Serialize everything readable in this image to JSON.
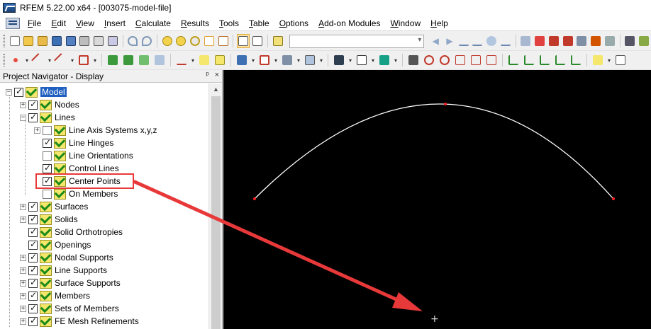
{
  "window": {
    "title": "RFEM 5.22.00 x64 - [003075-model-file]"
  },
  "menu": [
    {
      "label": "File",
      "key": "F",
      "rest": "ile"
    },
    {
      "label": "Edit",
      "key": "E",
      "rest": "dit"
    },
    {
      "label": "View",
      "key": "V",
      "rest": "iew"
    },
    {
      "label": "Insert",
      "key": "I",
      "rest": "nsert"
    },
    {
      "label": "Calculate",
      "key": "C",
      "rest": "alculate"
    },
    {
      "label": "Results",
      "key": "R",
      "rest": "esults"
    },
    {
      "label": "Tools",
      "key": "T",
      "rest": "ools"
    },
    {
      "label": "Table",
      "key": "T",
      "rest": "able"
    },
    {
      "label": "Options",
      "key": "O",
      "rest": "ptions"
    },
    {
      "label": "Add-on Modules",
      "key": "A",
      "rest": "dd-on Modules"
    },
    {
      "label": "Window",
      "key": "W",
      "rest": "indow"
    },
    {
      "label": "Help",
      "key": "H",
      "rest": "elp"
    }
  ],
  "navigator": {
    "title": "Project Navigator - Display",
    "pin_glyph": "ᵖ",
    "close_glyph": "×",
    "items": [
      {
        "label": "Model",
        "checked": true,
        "selected": true
      },
      {
        "label": "Nodes",
        "checked": true
      },
      {
        "label": "Lines",
        "checked": true
      },
      {
        "label": "Line Axis Systems x,y,z",
        "checked": false
      },
      {
        "label": "Line Hinges",
        "checked": true
      },
      {
        "label": "Line Orientations",
        "checked": false
      },
      {
        "label": "Control Lines",
        "checked": true
      },
      {
        "label": "Center Points",
        "checked": true
      },
      {
        "label": "On Members",
        "checked": false
      },
      {
        "label": "Surfaces",
        "checked": true
      },
      {
        "label": "Solids",
        "checked": true
      },
      {
        "label": "Solid Orthotropies",
        "checked": true
      },
      {
        "label": "Openings",
        "checked": true
      },
      {
        "label": "Nodal Supports",
        "checked": true
      },
      {
        "label": "Line Supports",
        "checked": true
      },
      {
        "label": "Surface Supports",
        "checked": true
      },
      {
        "label": "Members",
        "checked": true
      },
      {
        "label": "Sets of Members",
        "checked": true
      },
      {
        "label": "FE Mesh Refinements",
        "checked": true
      }
    ]
  },
  "canvas": {
    "background": "#000000",
    "line_color": "#ffffff",
    "node_color": "#ff2020",
    "annotation_color": "#e8393a",
    "cursor_glyph": "+"
  }
}
